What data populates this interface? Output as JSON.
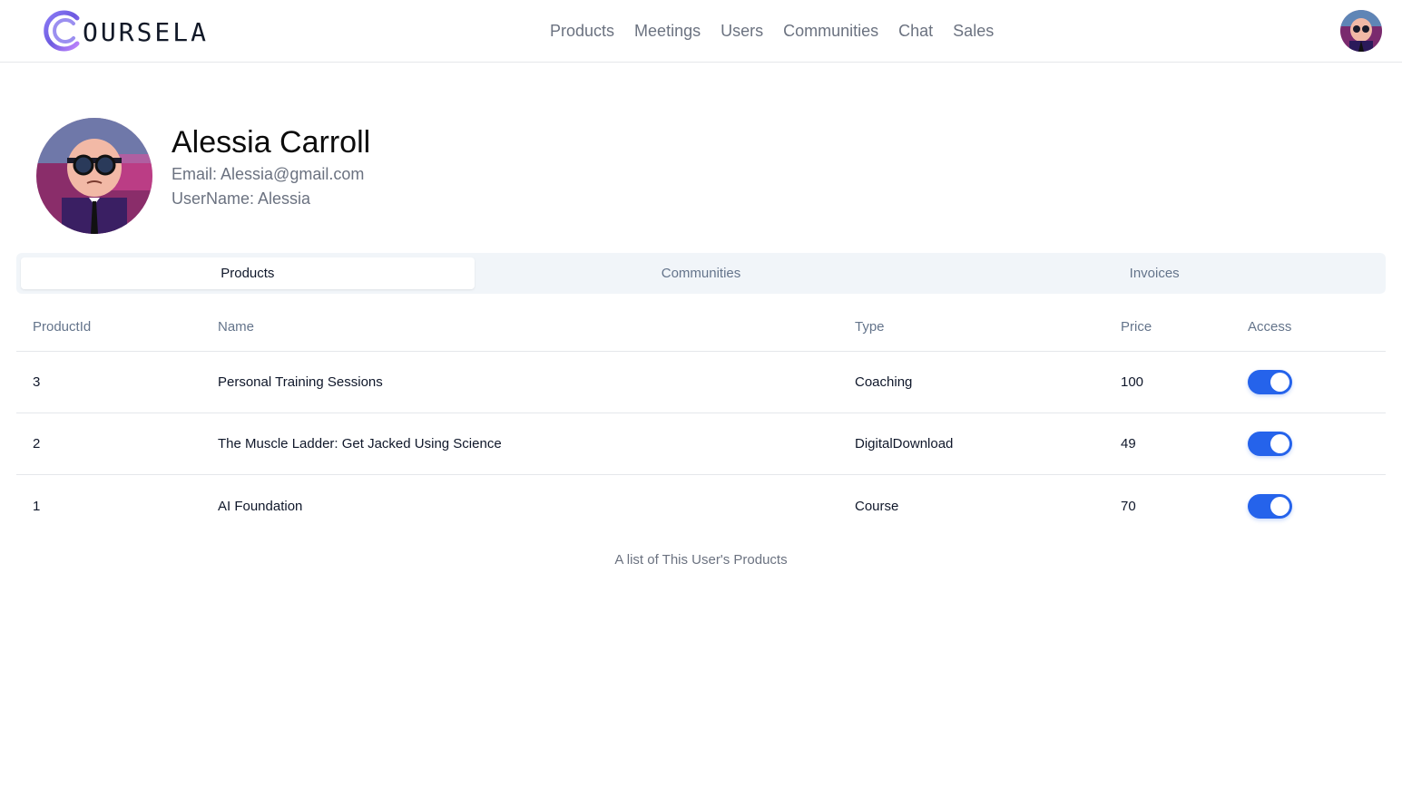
{
  "brand": {
    "logo_text": "OURSELA",
    "accent": "#7c6ee6"
  },
  "nav": {
    "items": [
      {
        "label": "Products"
      },
      {
        "label": "Meetings"
      },
      {
        "label": "Users"
      },
      {
        "label": "Communities"
      },
      {
        "label": "Chat"
      },
      {
        "label": "Sales"
      }
    ]
  },
  "profile": {
    "name": "Alessia Carroll",
    "email": "Email: Alessia@gmail.com",
    "username": "UserName: Alessia"
  },
  "tabs": [
    {
      "label": "Products",
      "active": true
    },
    {
      "label": "Communities",
      "active": false
    },
    {
      "label": "Invoices",
      "active": false
    }
  ],
  "table": {
    "headers": {
      "id": "ProductId",
      "name": "Name",
      "type": "Type",
      "price": "Price",
      "access": "Access"
    },
    "rows": [
      {
        "id": "3",
        "name": "Personal Training Sessions",
        "type": "Coaching",
        "price": "100",
        "access": true
      },
      {
        "id": "2",
        "name": "The Muscle Ladder: Get Jacked Using Science",
        "type": "DigitalDownload",
        "price": "49",
        "access": true
      },
      {
        "id": "1",
        "name": "AI Foundation",
        "type": "Course",
        "price": "70",
        "access": true
      }
    ],
    "caption": "A list of This User's Products"
  },
  "colors": {
    "toggle_on": "#2563eb",
    "tab_bg": "#f1f5f9",
    "muted_text": "#6b7280"
  }
}
